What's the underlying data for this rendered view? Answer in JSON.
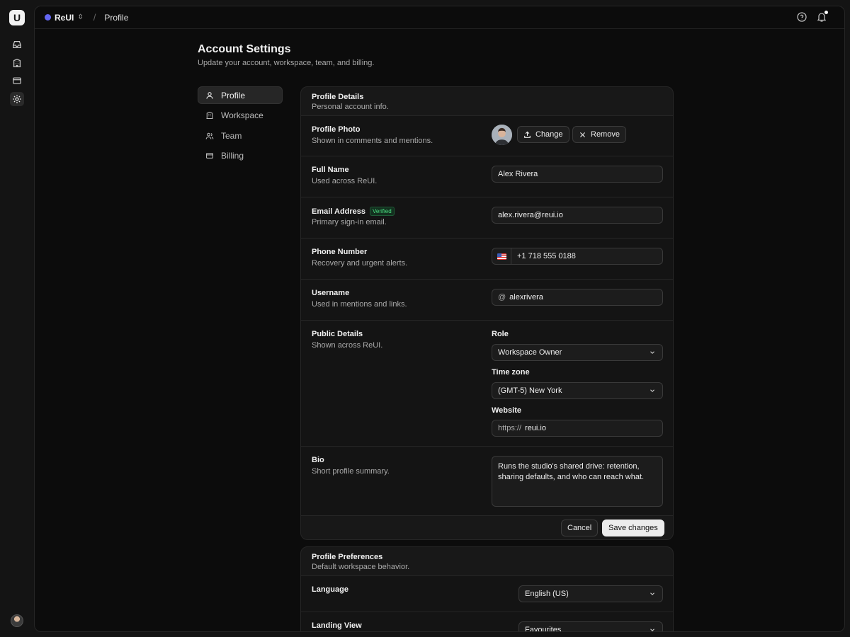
{
  "topbar": {
    "workspace": "ReUI",
    "crumb": "Profile"
  },
  "page": {
    "title": "Account Settings",
    "subtitle": "Update your account, workspace, team, and billing."
  },
  "nav": {
    "items": [
      "Profile",
      "Workspace",
      "Team",
      "Billing"
    ]
  },
  "profile": {
    "title": "Profile Details",
    "subtitle": "Personal account info.",
    "photo": {
      "label": "Profile Photo",
      "desc": "Shown in comments and mentions.",
      "change": "Change",
      "remove": "Remove"
    },
    "name": {
      "label": "Full Name",
      "desc": "Used across ReUI.",
      "value": "Alex Rivera"
    },
    "email": {
      "label": "Email Address",
      "badge": "Verified",
      "desc": "Primary sign-in email.",
      "value": "alex.rivera@reui.io"
    },
    "phone": {
      "label": "Phone Number",
      "desc": "Recovery and urgent alerts.",
      "value": "+1 718 555 0188"
    },
    "username": {
      "label": "Username",
      "desc": "Used in mentions and links.",
      "prefix": "@",
      "value": "alexrivera"
    },
    "public": {
      "label": "Public Details",
      "desc": "Shown across ReUI.",
      "role_label": "Role",
      "role": "Workspace Owner",
      "tz_label": "Time zone",
      "tz": "(GMT-5) New York",
      "web_label": "Website",
      "web_prefix": "https://",
      "web": "reui.io"
    },
    "bio": {
      "label": "Bio",
      "desc": "Short profile summary.",
      "value": "Runs the studio's shared drive: retention, sharing defaults, and who can reach what."
    },
    "cancel": "Cancel",
    "save": "Save changes"
  },
  "prefs": {
    "title": "Profile Preferences",
    "subtitle": "Default workspace behavior.",
    "language": {
      "label": "Language",
      "value": "English (US)"
    },
    "landing": {
      "label": "Landing View",
      "value": "Favourites"
    }
  }
}
